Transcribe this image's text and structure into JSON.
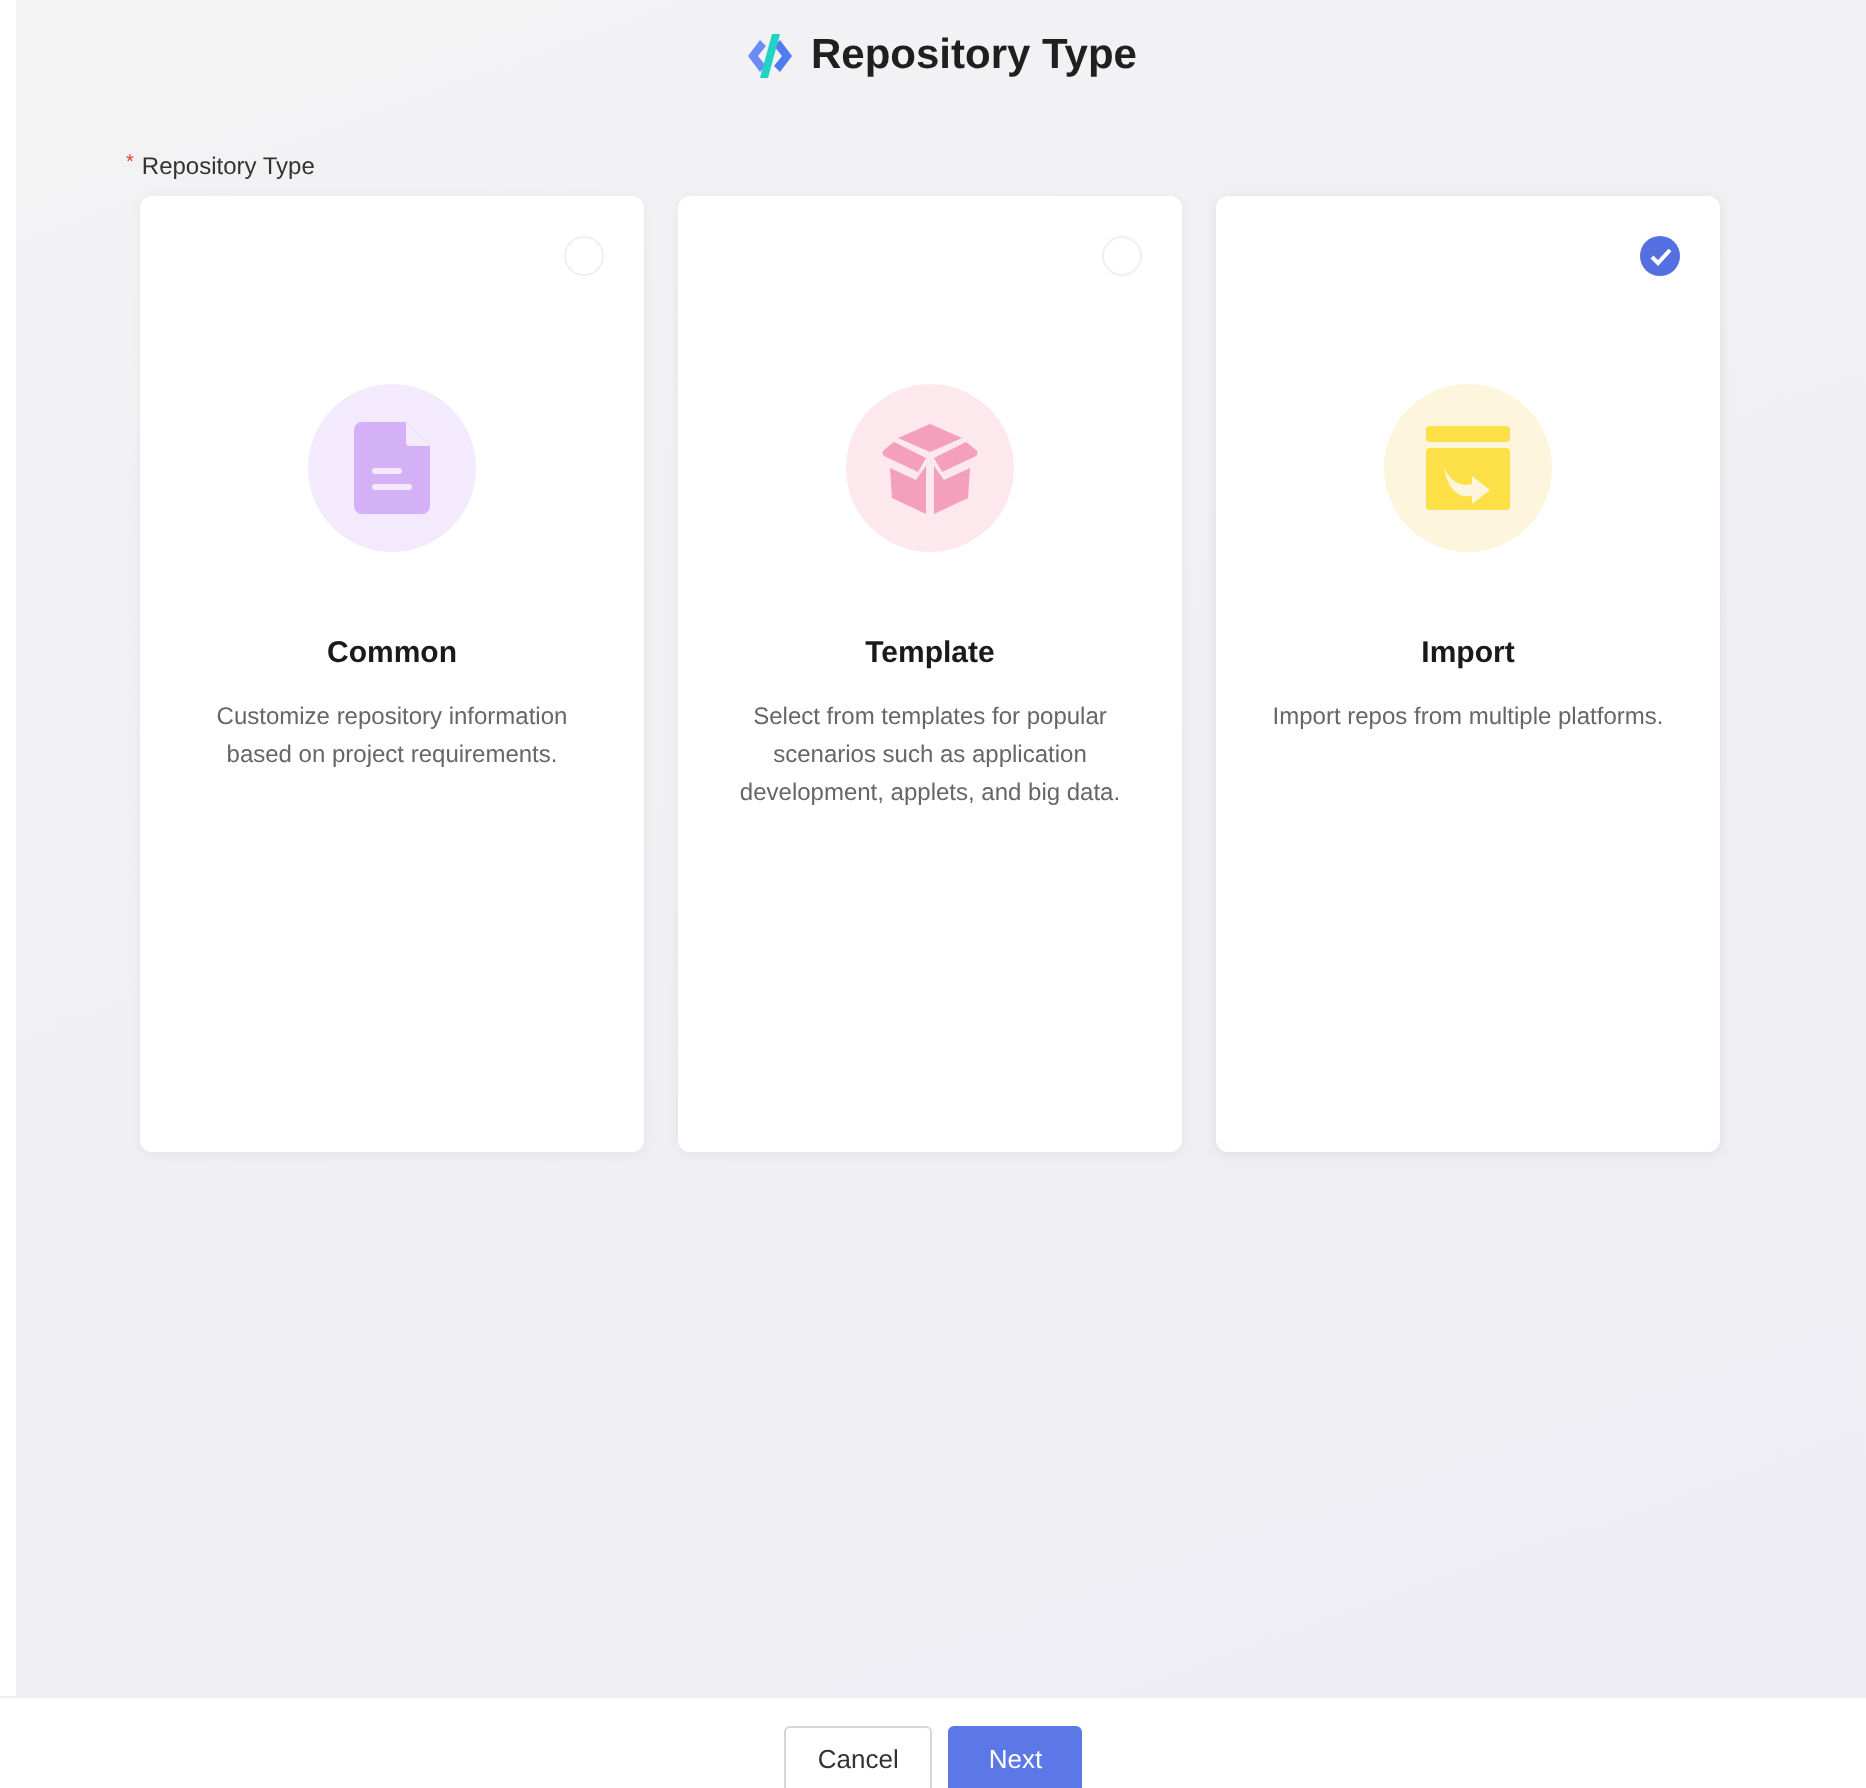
{
  "title": "Repository Type",
  "field": {
    "label": "Repository Type",
    "required_mark": "*"
  },
  "cards": [
    {
      "kind": "document",
      "title": "Common",
      "description": "Customize repository information based on project requirements.",
      "selected": false
    },
    {
      "kind": "box",
      "title": "Template",
      "description": "Select from templates for popular scenarios such as application development, applets, and big data.",
      "selected": false
    },
    {
      "kind": "import",
      "title": "Import",
      "description": "Import repos from multiple platforms.",
      "selected": true
    }
  ],
  "buttons": [
    {
      "label": "Cancel",
      "kind": "secondary"
    },
    {
      "label": "Next",
      "kind": "primary"
    }
  ]
}
